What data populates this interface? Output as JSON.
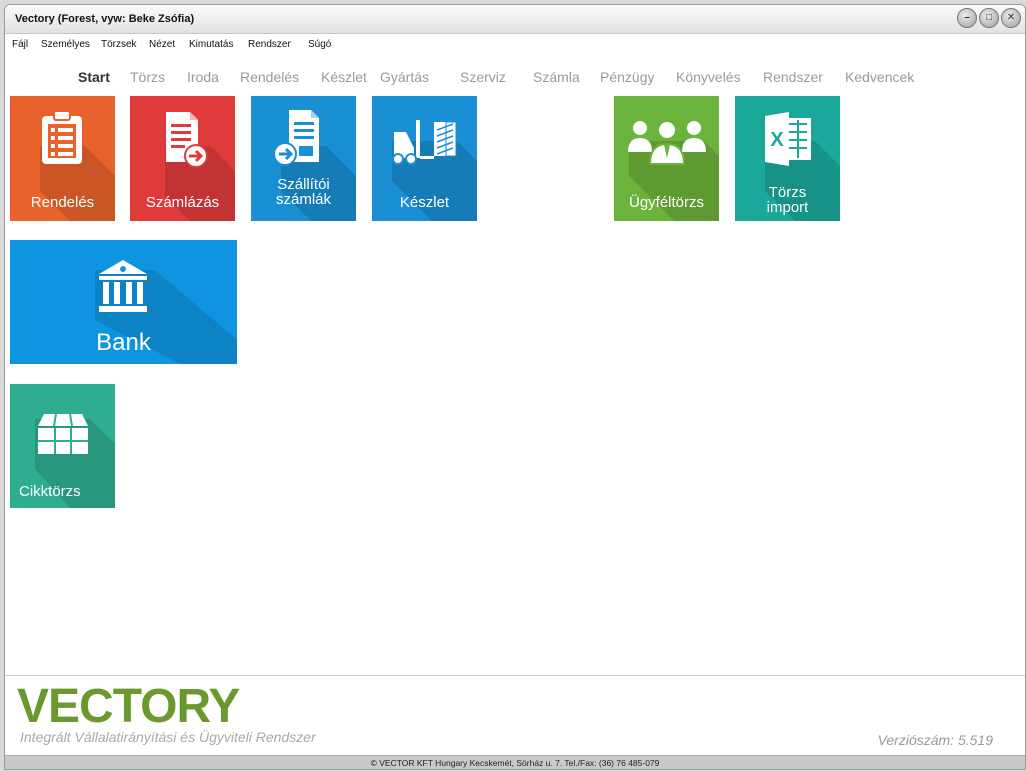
{
  "window": {
    "title": "Vectory (Forest, vyw: Beke Zsófia)",
    "controls": [
      "minimize-icon",
      "maximize-icon",
      "close-icon"
    ],
    "control_glyphs": {
      "minimize": "–",
      "maximize": "□",
      "close": "✕"
    }
  },
  "menu": [
    "Fájl",
    "Személyes",
    "Törzsek",
    "Nézet",
    "Kimutatás",
    "Rendszer",
    "Súgó"
  ],
  "tabs": [
    "Start",
    "Törzs",
    "Iroda",
    "Rendelés",
    "Készlet",
    "Gyártás",
    "Szerviz",
    "Számla",
    "Pénzügy",
    "Könyvelés",
    "Rendszer",
    "Kedvencek"
  ],
  "active_tab": "Start",
  "tiles": {
    "rendeles": {
      "label": "Rendelés",
      "color": "#e8632b",
      "icon": "clipboard-list-icon"
    },
    "szamlazas": {
      "label": "Számlázás",
      "color": "#e03b3b",
      "icon": "invoice-arrow-icon"
    },
    "szallitoi": {
      "label1": "Szállítói",
      "label2": "számlák",
      "color": "#1a8fd4",
      "icon": "document-in-icon"
    },
    "keszlet": {
      "label": "Készlet",
      "color": "#1a8fd4",
      "icon": "forklift-icon"
    },
    "ugyfeltorzs": {
      "label": "Ügyféltörzs",
      "color": "#6bb33a",
      "icon": "people-group-icon"
    },
    "torzsimport": {
      "label1": "Törzs",
      "label2": "import",
      "color": "#1aa89b",
      "icon": "excel-icon"
    },
    "bank": {
      "label": "Bank",
      "color": "#0f95e0",
      "icon": "bank-icon"
    },
    "cikktorzs": {
      "label": "Cikktörzs",
      "color": "#2fae8f",
      "icon": "grid-box-icon"
    }
  },
  "footer": {
    "logo": "VECTORY",
    "subtitle": "Integrált Vállalatirányítási és Ügyviteli Rendszer",
    "version": "Verziószám: 5.519",
    "status": "© VECTOR KFT   Hungary Kecskemét, Sörház u. 7.  Tel./Fax: (36) 76 485-079"
  }
}
